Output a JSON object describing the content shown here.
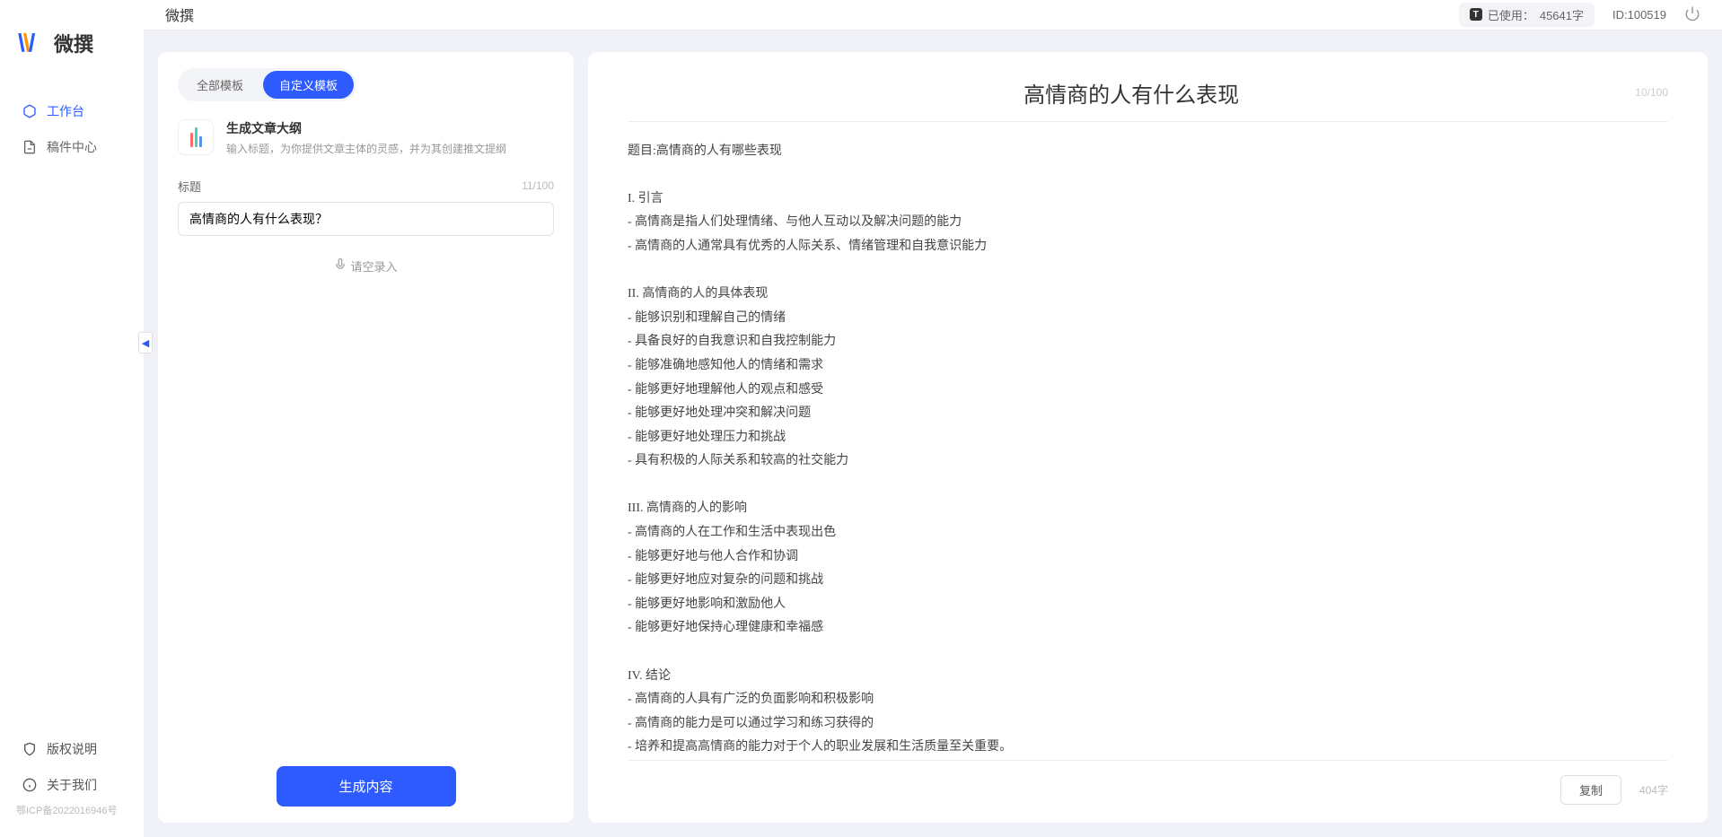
{
  "app": {
    "name": "微撰",
    "logo_text": "微撰"
  },
  "sidebar": {
    "nav": [
      {
        "label": "工作台",
        "icon": "cube"
      },
      {
        "label": "稿件中心",
        "icon": "doc"
      }
    ],
    "bottom": [
      {
        "label": "版权说明",
        "icon": "shield"
      },
      {
        "label": "关于我们",
        "icon": "info"
      }
    ],
    "icp": "鄂ICP备2022016946号"
  },
  "topbar": {
    "usage_label": "已使用：",
    "usage_value": "45641字",
    "id_label": "ID:100519"
  },
  "leftPanel": {
    "tabs": [
      {
        "label": "全部模板",
        "active": false
      },
      {
        "label": "自定义模板",
        "active": true
      }
    ],
    "template": {
      "title": "生成文章大纲",
      "desc": "输入标题，为你提供文章主体的灵感，并为其创建推文提纲"
    },
    "form": {
      "label": "标题",
      "char_count": "11/100",
      "input_value": "高情商的人有什么表现？",
      "voice_label": "请空录入"
    },
    "generate_btn": "生成内容"
  },
  "rightPanel": {
    "title": "高情商的人有什么表现",
    "title_count": "10/100",
    "body": "题目:高情商的人有哪些表现\n\nI. 引言\n- 高情商是指人们处理情绪、与他人互动以及解决问题的能力\n- 高情商的人通常具有优秀的人际关系、情绪管理和自我意识能力\n\nII. 高情商的人的具体表现\n- 能够识别和理解自己的情绪\n- 具备良好的自我意识和自我控制能力\n- 能够准确地感知他人的情绪和需求\n- 能够更好地理解他人的观点和感受\n- 能够更好地处理冲突和解决问题\n- 能够更好地处理压力和挑战\n- 具有积极的人际关系和较高的社交能力\n\nIII. 高情商的人的影响\n- 高情商的人在工作和生活中表现出色\n- 能够更好地与他人合作和协调\n- 能够更好地应对复杂的问题和挑战\n- 能够更好地影响和激励他人\n- 能够更好地保持心理健康和幸福感\n\nIV. 结论\n- 高情商的人具有广泛的负面影响和积极影响\n- 高情商的能力是可以通过学习和练习获得的\n- 培养和提高高情商的能力对于个人的职业发展和生活质量至关重要。",
    "copy_btn": "复制",
    "word_count": "404字"
  }
}
